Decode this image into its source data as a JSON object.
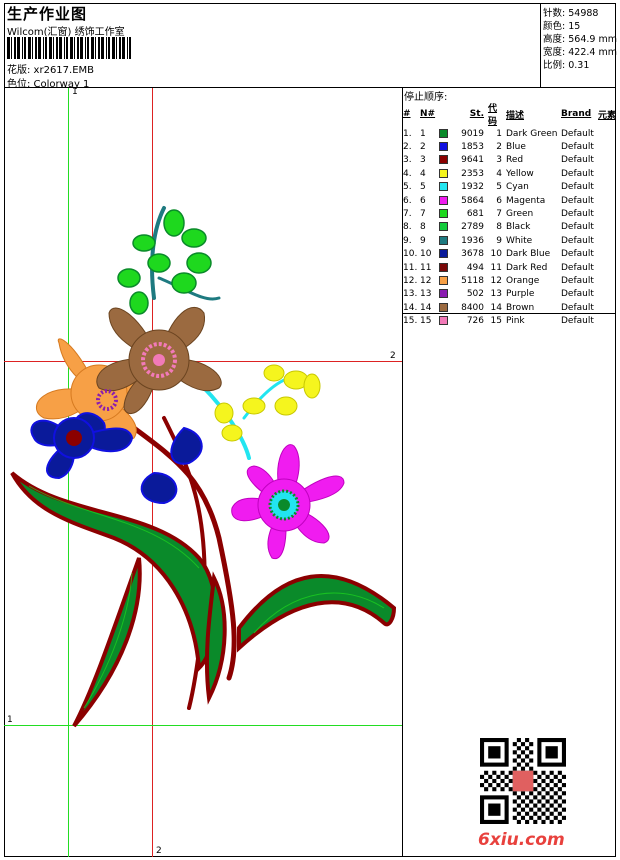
{
  "header": {
    "title": "生产作业图",
    "company": "Wilcom(汇窗)  绣饰工作室",
    "design_label": "花版: xr2617.EMB",
    "colorway_label": "色位: Colorway 1"
  },
  "stats": [
    {
      "label": "针数:",
      "value": "54988"
    },
    {
      "label": "颜色:",
      "value": "15"
    },
    {
      "label": "高度:",
      "value": "564.9 mm"
    },
    {
      "label": "宽度:",
      "value": "422.4 mm"
    },
    {
      "label": "比例:",
      "value": "0.31"
    }
  ],
  "stop_sequence": {
    "title": "停止顺序:",
    "headers": {
      "index": "#",
      "num": "N#",
      "stitches": "St.",
      "code": "代码",
      "desc": "描述",
      "brand": "Brand",
      "elements": "元素"
    },
    "rows": [
      {
        "i": "1.",
        "n": "1",
        "st": "9019",
        "code": "1",
        "desc": "Dark Green",
        "brand": "Default",
        "color": "#0a8a2a"
      },
      {
        "i": "2.",
        "n": "2",
        "st": "1853",
        "code": "2",
        "desc": "Blue",
        "brand": "Default",
        "color": "#1010e0"
      },
      {
        "i": "3.",
        "n": "3",
        "st": "9641",
        "code": "3",
        "desc": "Red",
        "brand": "Default",
        "color": "#8b0000"
      },
      {
        "i": "4.",
        "n": "4",
        "st": "2353",
        "code": "4",
        "desc": "Yellow",
        "brand": "Default",
        "color": "#f5f51e"
      },
      {
        "i": "5.",
        "n": "5",
        "st": "1932",
        "code": "5",
        "desc": "Cyan",
        "brand": "Default",
        "color": "#22e5f0"
      },
      {
        "i": "6.",
        "n": "6",
        "st": "5864",
        "code": "6",
        "desc": "Magenta",
        "brand": "Default",
        "color": "#f01cf0"
      },
      {
        "i": "7.",
        "n": "7",
        "st": "681",
        "code": "7",
        "desc": "Green",
        "brand": "Default",
        "color": "#1ed81e"
      },
      {
        "i": "8.",
        "n": "8",
        "st": "2789",
        "code": "8",
        "desc": "Black",
        "brand": "Default",
        "color": "#14cc3c"
      },
      {
        "i": "9.",
        "n": "9",
        "st": "1936",
        "code": "9",
        "desc": "White",
        "brand": "Default",
        "color": "#1e7a80"
      },
      {
        "i": "10.",
        "n": "10",
        "st": "3678",
        "code": "10",
        "desc": "Dark Blue",
        "brand": "Default",
        "color": "#0a1a9a"
      },
      {
        "i": "11.",
        "n": "11",
        "st": "494",
        "code": "11",
        "desc": "Dark Red",
        "brand": "Default",
        "color": "#7a0808"
      },
      {
        "i": "12.",
        "n": "12",
        "st": "5118",
        "code": "12",
        "desc": "Orange",
        "brand": "Default",
        "color": "#f7a046"
      },
      {
        "i": "13.",
        "n": "13",
        "st": "502",
        "code": "13",
        "desc": "Purple",
        "brand": "Default",
        "color": "#8a1cb0"
      },
      {
        "i": "14.",
        "n": "14",
        "st": "8400",
        "code": "14",
        "desc": "Brown",
        "brand": "Default",
        "color": "#9b6a40"
      },
      {
        "i": "15.",
        "n": "15",
        "st": "726",
        "code": "15",
        "desc": "Pink",
        "brand": "Default",
        "color": "#f27ab8"
      }
    ]
  },
  "guides": {
    "v1_label": "1",
    "h2_label": "2",
    "h1_label": "1",
    "v2_label": "2"
  },
  "colors": {
    "guide_green": "#22dd22",
    "guide_red": "#dd2222"
  },
  "watermark": "6xiu.com"
}
